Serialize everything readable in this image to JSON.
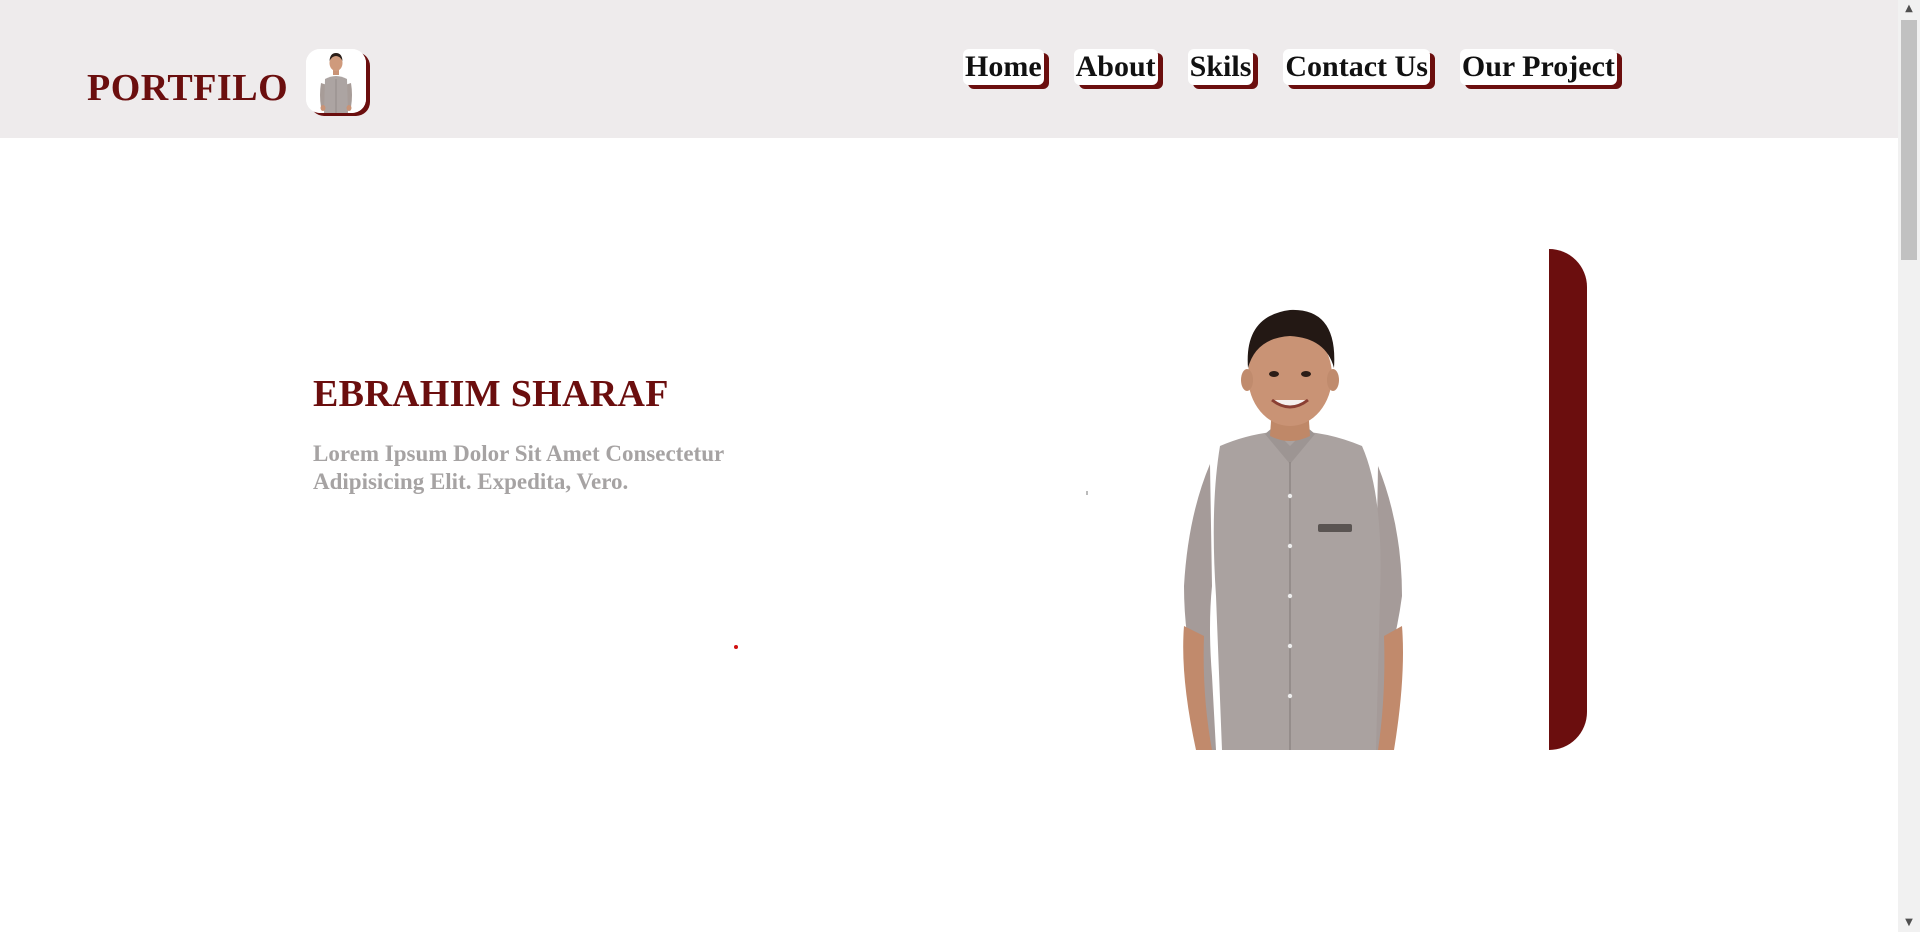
{
  "header": {
    "brand": "PORTFILO",
    "nav": [
      {
        "label": "Home"
      },
      {
        "label": "About"
      },
      {
        "label": "Skils"
      },
      {
        "label": "Contact Us"
      },
      {
        "label": "Our Project"
      }
    ]
  },
  "hero": {
    "name": "EBRAHIM SHARAF",
    "description": "Lorem Ipsum Dolor Sit Amet Consectetur Adipisicing Elit. Expedita, Vero."
  },
  "colors": {
    "accent": "#6b0e0e",
    "header_bg": "#eeebec",
    "muted_text": "#a6a3a3"
  },
  "icons": {
    "scroll_up": "scroll-up-arrow-icon",
    "scroll_down": "scroll-down-arrow-icon"
  }
}
